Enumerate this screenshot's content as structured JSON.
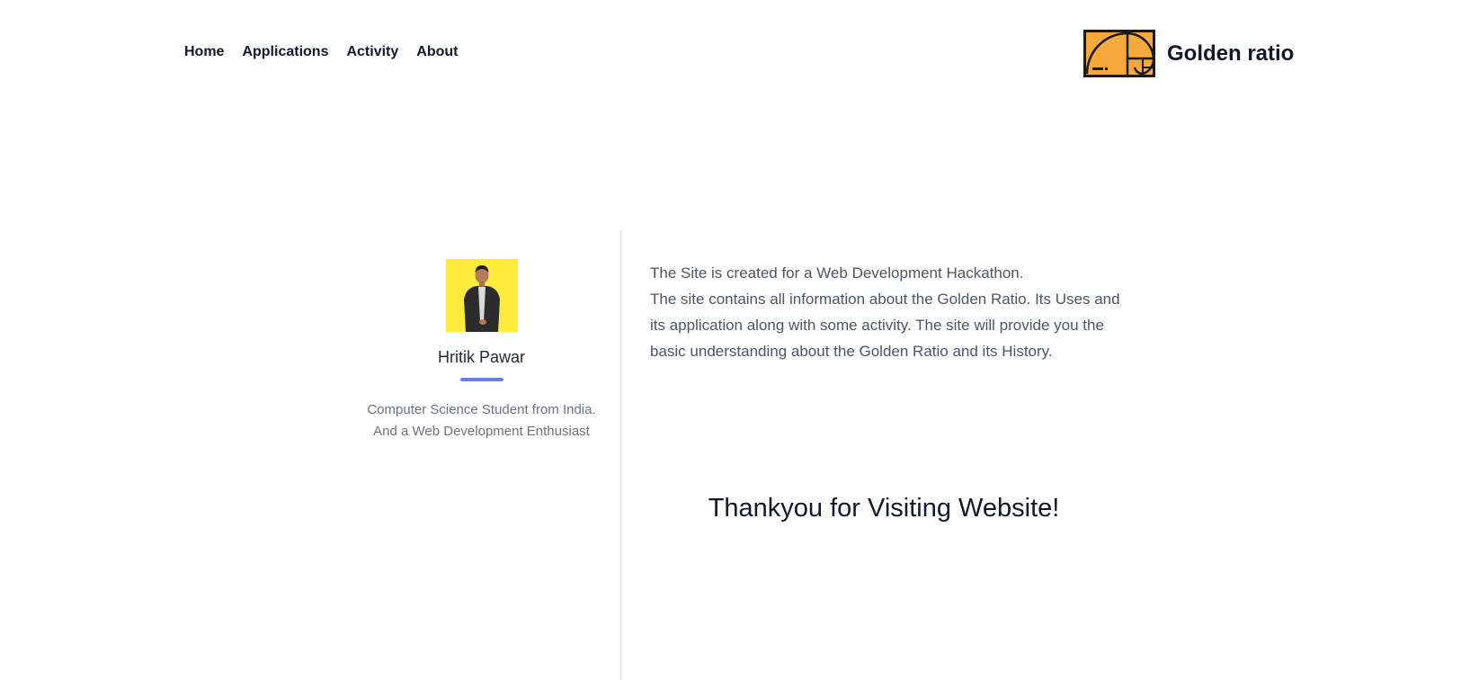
{
  "header": {
    "nav": [
      {
        "label": "Home"
      },
      {
        "label": "Applications"
      },
      {
        "label": "Activity"
      },
      {
        "label": "About"
      }
    ],
    "brand": {
      "name": "Golden ratio",
      "logo_icon": "golden-spiral-logo-icon",
      "logo_color": "#F4A93A"
    }
  },
  "profile": {
    "avatar_icon": "person-photo",
    "avatar_bg": "#FFEB3B",
    "name": "Hritik Pawar",
    "bio": "Computer Science Student from India. And a Web Development Enthusiast",
    "accent_color": "#6B7FE3"
  },
  "about": {
    "line1": "The Site is created for a Web Development Hackathon.",
    "line2": "The site contains all information about the Golden Ratio. Its Uses and its application along with some activity. The site will provide you the basic understanding about the Golden Ratio and its History."
  },
  "closing": {
    "text": "Thankyou for Visiting Website!"
  }
}
